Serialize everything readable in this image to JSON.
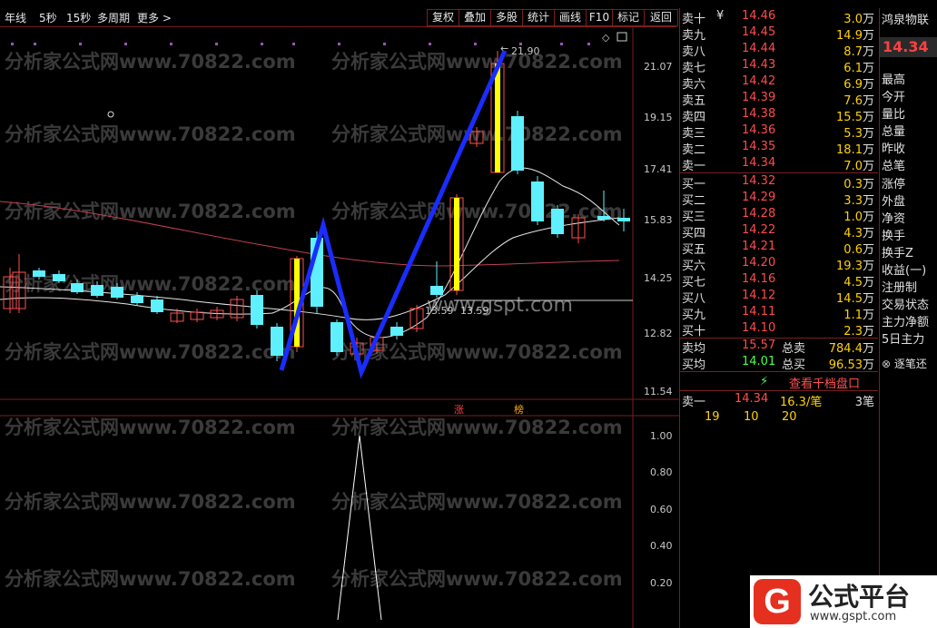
{
  "toolbar": {
    "periods": [
      "年线",
      "5秒",
      "15秒",
      "多周期",
      "更多 >"
    ],
    "buttons": [
      "复权",
      "叠加",
      "多股",
      "统计",
      "画线",
      "F10",
      "标记",
      "返回"
    ]
  },
  "chart": {
    "price_ticks": [
      "21.07",
      "19.15",
      "17.41",
      "15.83",
      "14.25",
      "12.82",
      "11.54"
    ],
    "indicator_ticks": [
      "1.00",
      "0.80",
      "0.60",
      "0.40",
      "0.20"
    ],
    "high_marker": "21.90",
    "crosshair_label": "13.59",
    "crosshair_label2": "13.59",
    "badge_1": "涨",
    "badge_2": "榜",
    "watermark": "分析家公式网www.70822.com",
    "watermark_center": "www.gspt.com",
    "colors": {
      "up": "#ffff00",
      "down": "#5ef0ff",
      "ma_white": "#e8e8e8",
      "ma_red": "#c04050",
      "zigzag": "#1a2cff"
    }
  },
  "orderbook": {
    "sells": [
      {
        "label": "卖十",
        "price": "14.46",
        "vol": "3.0",
        "unit": "万",
        "tag": "¥"
      },
      {
        "label": "卖九",
        "price": "14.45",
        "vol": "14.9",
        "unit": "万"
      },
      {
        "label": "卖八",
        "price": "14.44",
        "vol": "8.7",
        "unit": "万"
      },
      {
        "label": "卖七",
        "price": "14.43",
        "vol": "6.1",
        "unit": "万"
      },
      {
        "label": "卖六",
        "price": "14.42",
        "vol": "6.9",
        "unit": "万"
      },
      {
        "label": "卖五",
        "price": "14.39",
        "vol": "7.6",
        "unit": "万"
      },
      {
        "label": "卖四",
        "price": "14.38",
        "vol": "15.5",
        "unit": "万"
      },
      {
        "label": "卖三",
        "price": "14.36",
        "vol": "5.3",
        "unit": "万"
      },
      {
        "label": "卖二",
        "price": "14.35",
        "vol": "18.1",
        "unit": "万"
      },
      {
        "label": "卖一",
        "price": "14.34",
        "vol": "7.0",
        "unit": "万"
      }
    ],
    "buys": [
      {
        "label": "买一",
        "price": "14.32",
        "vol": "0.3",
        "unit": "万"
      },
      {
        "label": "买二",
        "price": "14.29",
        "vol": "3.3",
        "unit": "万"
      },
      {
        "label": "买三",
        "price": "14.28",
        "vol": "1.0",
        "unit": "万"
      },
      {
        "label": "买四",
        "price": "14.22",
        "vol": "4.3",
        "unit": "万"
      },
      {
        "label": "买五",
        "price": "14.21",
        "vol": "0.6",
        "unit": "万"
      },
      {
        "label": "买六",
        "price": "14.20",
        "vol": "19.3",
        "unit": "万"
      },
      {
        "label": "买七",
        "price": "14.16",
        "vol": "4.5",
        "unit": "万"
      },
      {
        "label": "买八",
        "price": "14.12",
        "vol": "14.5",
        "unit": "万"
      },
      {
        "label": "买九",
        "price": "14.11",
        "vol": "1.1",
        "unit": "万"
      },
      {
        "label": "买十",
        "price": "14.10",
        "vol": "2.3",
        "unit": "万"
      }
    ],
    "avg_sell": {
      "label": "卖均",
      "price": "15.57",
      "tlabel": "总卖",
      "total": "784.4",
      "unit": "万"
    },
    "avg_buy": {
      "label": "买均",
      "price": "14.01",
      "tlabel": "总买",
      "total": "96.53",
      "unit": "万"
    },
    "view_1000": "查看千档盘口",
    "trade_label": "卖一",
    "trade_price": "14.34",
    "trade_per": "16.3/笔",
    "trade_count": "3笔",
    "queue": [
      "19",
      "10",
      "20"
    ]
  },
  "sidebar": {
    "stock_name": "鸿泉物联",
    "last_price": "14.34",
    "fields": [
      "最高",
      "今开",
      "量比",
      "总量",
      "昨收",
      "总笔",
      "涨停",
      "外盘",
      "净资",
      "换手",
      "换手Z",
      "收益(一)",
      "注册制",
      "交易状态",
      "主力净额",
      "5日主力"
    ],
    "trade_tab": "逐笔还"
  },
  "logo": {
    "text": "公式平台",
    "url": "www.gspt.com"
  }
}
